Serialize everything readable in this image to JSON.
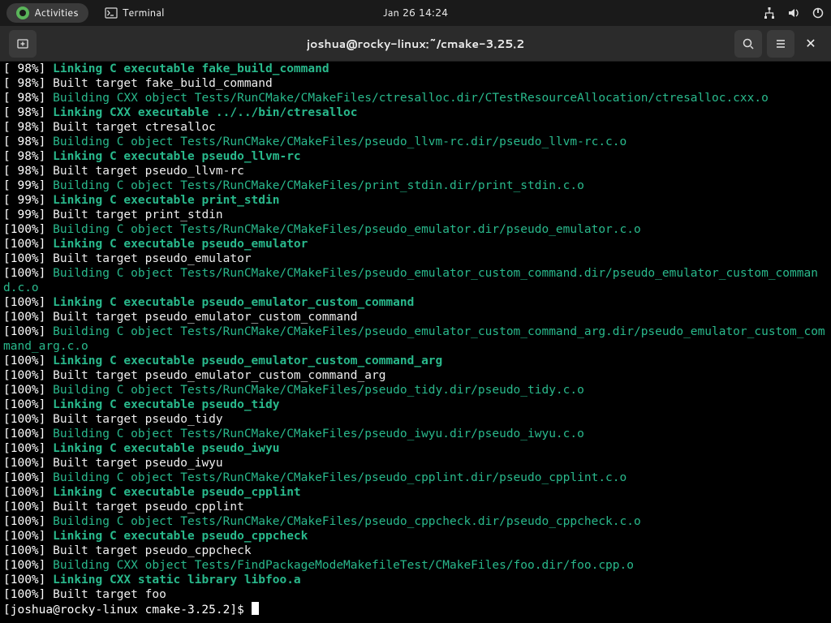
{
  "topbar": {
    "activities": "Activities",
    "app": "Terminal",
    "clock": "Jan 26  14:24"
  },
  "titlebar": {
    "title": "joshua@rocky-linux:~/cmake-3.25.2"
  },
  "prompt": "[joshua@rocky-linux cmake-3.25.2]$ ",
  "lines": [
    {
      "pct": "[ 98%]",
      "cls": "b-green",
      "txt": "Linking C executable fake_build_command"
    },
    {
      "pct": "[ 98%]",
      "cls": "white",
      "txt": "Built target fake_build_command"
    },
    {
      "pct": "[ 98%]",
      "cls": "green",
      "txt": "Building CXX object Tests/RunCMake/CMakeFiles/ctresalloc.dir/CTestResourceAllocation/ctresalloc.cxx.o"
    },
    {
      "pct": "[ 98%]",
      "cls": "b-green",
      "txt": "Linking CXX executable ../../bin/ctresalloc"
    },
    {
      "pct": "[ 98%]",
      "cls": "white",
      "txt": "Built target ctresalloc"
    },
    {
      "pct": "[ 98%]",
      "cls": "green",
      "txt": "Building C object Tests/RunCMake/CMakeFiles/pseudo_llvm-rc.dir/pseudo_llvm-rc.c.o"
    },
    {
      "pct": "[ 98%]",
      "cls": "b-green",
      "txt": "Linking C executable pseudo_llvm-rc"
    },
    {
      "pct": "[ 98%]",
      "cls": "white",
      "txt": "Built target pseudo_llvm-rc"
    },
    {
      "pct": "[ 99%]",
      "cls": "green",
      "txt": "Building C object Tests/RunCMake/CMakeFiles/print_stdin.dir/print_stdin.c.o"
    },
    {
      "pct": "[ 99%]",
      "cls": "b-green",
      "txt": "Linking C executable print_stdin"
    },
    {
      "pct": "[ 99%]",
      "cls": "white",
      "txt": "Built target print_stdin"
    },
    {
      "pct": "[100%]",
      "cls": "green",
      "txt": "Building C object Tests/RunCMake/CMakeFiles/pseudo_emulator.dir/pseudo_emulator.c.o"
    },
    {
      "pct": "[100%]",
      "cls": "b-green",
      "txt": "Linking C executable pseudo_emulator"
    },
    {
      "pct": "[100%]",
      "cls": "white",
      "txt": "Built target pseudo_emulator"
    },
    {
      "pct": "[100%]",
      "cls": "green",
      "txt": "Building C object Tests/RunCMake/CMakeFiles/pseudo_emulator_custom_command.dir/pseudo_emulator_custom_command.c.o"
    },
    {
      "pct": "[100%]",
      "cls": "b-green",
      "txt": "Linking C executable pseudo_emulator_custom_command"
    },
    {
      "pct": "[100%]",
      "cls": "white",
      "txt": "Built target pseudo_emulator_custom_command"
    },
    {
      "pct": "[100%]",
      "cls": "green",
      "txt": "Building C object Tests/RunCMake/CMakeFiles/pseudo_emulator_custom_command_arg.dir/pseudo_emulator_custom_command_arg.c.o"
    },
    {
      "pct": "[100%]",
      "cls": "b-green",
      "txt": "Linking C executable pseudo_emulator_custom_command_arg"
    },
    {
      "pct": "[100%]",
      "cls": "white",
      "txt": "Built target pseudo_emulator_custom_command_arg"
    },
    {
      "pct": "[100%]",
      "cls": "green",
      "txt": "Building C object Tests/RunCMake/CMakeFiles/pseudo_tidy.dir/pseudo_tidy.c.o"
    },
    {
      "pct": "[100%]",
      "cls": "b-green",
      "txt": "Linking C executable pseudo_tidy"
    },
    {
      "pct": "[100%]",
      "cls": "white",
      "txt": "Built target pseudo_tidy"
    },
    {
      "pct": "[100%]",
      "cls": "green",
      "txt": "Building C object Tests/RunCMake/CMakeFiles/pseudo_iwyu.dir/pseudo_iwyu.c.o"
    },
    {
      "pct": "[100%]",
      "cls": "b-green",
      "txt": "Linking C executable pseudo_iwyu"
    },
    {
      "pct": "[100%]",
      "cls": "white",
      "txt": "Built target pseudo_iwyu"
    },
    {
      "pct": "[100%]",
      "cls": "green",
      "txt": "Building C object Tests/RunCMake/CMakeFiles/pseudo_cpplint.dir/pseudo_cpplint.c.o"
    },
    {
      "pct": "[100%]",
      "cls": "b-green",
      "txt": "Linking C executable pseudo_cpplint"
    },
    {
      "pct": "[100%]",
      "cls": "white",
      "txt": "Built target pseudo_cpplint"
    },
    {
      "pct": "[100%]",
      "cls": "green",
      "txt": "Building C object Tests/RunCMake/CMakeFiles/pseudo_cppcheck.dir/pseudo_cppcheck.c.o"
    },
    {
      "pct": "[100%]",
      "cls": "b-green",
      "txt": "Linking C executable pseudo_cppcheck"
    },
    {
      "pct": "[100%]",
      "cls": "white",
      "txt": "Built target pseudo_cppcheck"
    },
    {
      "pct": "[100%]",
      "cls": "green",
      "txt": "Building CXX object Tests/FindPackageModeMakefileTest/CMakeFiles/foo.dir/foo.cpp.o"
    },
    {
      "pct": "[100%]",
      "cls": "b-green",
      "txt": "Linking CXX static library libfoo.a"
    },
    {
      "pct": "[100%]",
      "cls": "white",
      "txt": "Built target foo"
    }
  ]
}
